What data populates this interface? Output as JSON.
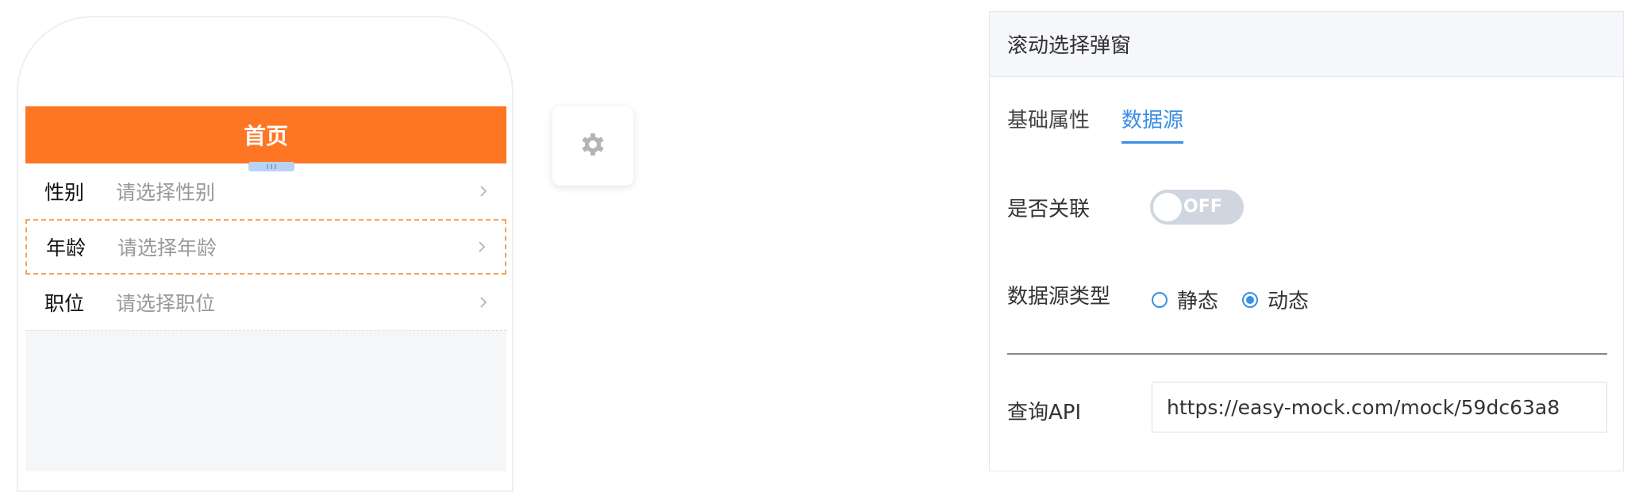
{
  "phone": {
    "header_title": "首页",
    "rows": [
      {
        "label": "性别",
        "placeholder": "请选择性别",
        "icon": "chevron-right-icon"
      },
      {
        "label": "年龄",
        "placeholder": "请选择年龄",
        "icon": "chevron-right-icon",
        "selected": true
      },
      {
        "label": "职位",
        "placeholder": "请选择职位",
        "icon": "chevron-right-icon"
      }
    ],
    "header_color": "#fe7624"
  },
  "toolbar": {
    "settings_icon": "gear-icon"
  },
  "panel": {
    "title": "滚动选择弹窗",
    "tabs": [
      {
        "label": "基础属性",
        "active": false
      },
      {
        "label": "数据源",
        "active": true
      }
    ],
    "association": {
      "label": "是否关联",
      "toggle_text": "OFF",
      "value": false
    },
    "source_type": {
      "label": "数据源类型",
      "options": [
        {
          "label": "静态",
          "checked": false
        },
        {
          "label": "动态",
          "checked": true
        }
      ]
    },
    "api": {
      "label": "查询API",
      "value": "https://easy-mock.com/mock/59dc63a8"
    },
    "accent_color": "#3a8ee6"
  }
}
